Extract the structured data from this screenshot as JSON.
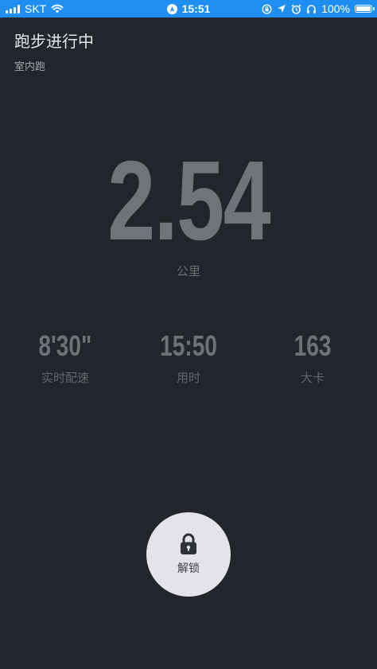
{
  "status_bar": {
    "carrier": "SKT",
    "time": "15:51",
    "battery": "100%",
    "background": "#1f8ef1",
    "icons": [
      "signal-icon",
      "wifi-icon",
      "location-icon",
      "screen-lock-icon",
      "navigation-icon",
      "alarm-icon",
      "headphones-icon",
      "battery-icon"
    ]
  },
  "header": {
    "title": "跑步进行中",
    "subtitle": "室内跑"
  },
  "distance": {
    "value": "2.54",
    "unit": "公里"
  },
  "metrics": [
    {
      "value": "8'30\"",
      "label": "实时配速"
    },
    {
      "value": "15:50",
      "label": "用时"
    },
    {
      "value": "163",
      "label": "大卡"
    }
  ],
  "unlock": {
    "label": "解锁",
    "icon": "lock-icon"
  },
  "colors": {
    "background": "#22252b",
    "accent": "#1f8ef1"
  }
}
